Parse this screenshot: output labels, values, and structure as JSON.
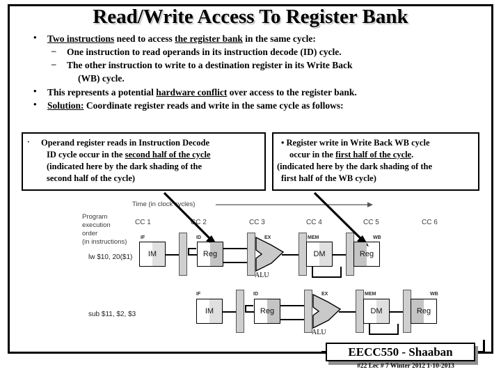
{
  "slide": {
    "title": "Read/Write Access To Register Bank"
  },
  "bullets": {
    "marker_dot": "•",
    "marker_dash": "–",
    "b1_a": "Two instructions",
    "b1_b": " need to access ",
    "b1_c": "the register bank",
    "b1_d": " in the same cycle:",
    "sub1": "One instruction to read operands in its instruction decode (ID) cycle.",
    "sub2": "The other instruction to write to a destination register in its Write Back",
    "sub2_cont": "(WB) cycle.",
    "b2_a": "This represents a potential ",
    "b2_b": "hardware conflict",
    "b2_c": " over access to the register bank.",
    "b3_a": "Solution:",
    "b3_b": "  Coordinate register reads and write in the same cycle as follows:"
  },
  "left_box": {
    "bullet": "·",
    "line1": "Operand register reads in Instruction Decode",
    "line2_a": "ID cycle occur in the ",
    "line2_b": "second half of the cycle",
    "line3": "(indicated here by  the dark shading of the",
    "line4": "second half of the cycle)"
  },
  "right_box": {
    "bullet": "•",
    "line1": "Register write in Write Back WB cycle",
    "line2_a": "occur in  the ",
    "line2_b": "first half of the cycle",
    "line2_c": ".",
    "line3": "(indicated here by the dark shading of the",
    "line4": "first half  of the WB cycle)"
  },
  "diagram": {
    "time_axis_label": "Time (in clock cycles)",
    "order_label_1": "Program",
    "order_label_2": "execution",
    "order_label_3": "order",
    "order_label_4": "(in instructions)",
    "cycles": [
      "CC 1",
      "CC 2",
      "CC 3",
      "CC 4",
      "CC 5",
      "CC 6"
    ],
    "rows": [
      {
        "instruction": "lw $10, 20($1)",
        "stages": [
          {
            "name": "IF",
            "unit": "IM",
            "shade": "right"
          },
          {
            "name": "ID",
            "unit": "Reg",
            "shade": "right"
          },
          {
            "name": "EX",
            "unit": "ALU",
            "shade": "none"
          },
          {
            "name": "MEM",
            "unit": "DM",
            "shade": "right"
          },
          {
            "name": "WB",
            "unit": "Reg",
            "shade": "left"
          }
        ]
      },
      {
        "instruction": "sub $11, $2, $3",
        "stages": [
          {
            "name": "IF",
            "unit": "IM",
            "shade": "right"
          },
          {
            "name": "ID",
            "unit": "Reg",
            "shade": "right"
          },
          {
            "name": "EX",
            "unit": "ALU",
            "shade": "none"
          },
          {
            "name": "MEM",
            "unit": "DM",
            "shade": "right"
          },
          {
            "name": "WB",
            "unit": "Reg",
            "shade": "left"
          }
        ]
      }
    ]
  },
  "footer": {
    "course": "EECC550 - Shaaban",
    "note": "#22   Lec # 7  Winter 2012  1-10-2013"
  },
  "colors": {
    "shade_dark": "#c4c4c4",
    "pipeline_register": "#cfcfcf",
    "title_shadow": "#c9c9c9",
    "text": "#000000"
  }
}
